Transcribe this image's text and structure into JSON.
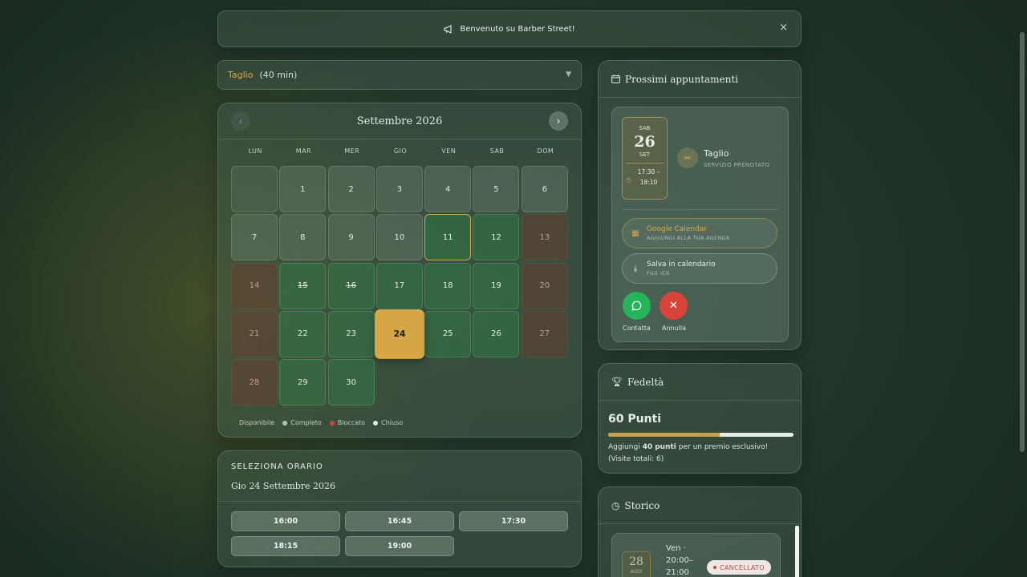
{
  "banner": {
    "icon": "megaphone-icon",
    "text": "Benvenuto su Barber Street!",
    "close": "×"
  },
  "service": {
    "name": "Taglio",
    "duration": "(40 min)",
    "arrow": "▼"
  },
  "calendar": {
    "month": "Settembre 2026",
    "prev": "‹",
    "next": "›",
    "weekdays": [
      "LUN",
      "MAR",
      "MER",
      "GIO",
      "VEN",
      "SAB",
      "DOM"
    ],
    "days": [
      {
        "d": "",
        "s": "empty"
      },
      {
        "d": "1",
        "s": "default"
      },
      {
        "d": "2",
        "s": "default"
      },
      {
        "d": "3",
        "s": "default"
      },
      {
        "d": "4",
        "s": "default"
      },
      {
        "d": "5",
        "s": "default"
      },
      {
        "d": "6",
        "s": "default"
      },
      {
        "d": "7",
        "s": "default"
      },
      {
        "d": "8",
        "s": "default"
      },
      {
        "d": "9",
        "s": "default"
      },
      {
        "d": "10",
        "s": "default"
      },
      {
        "d": "11",
        "s": "today"
      },
      {
        "d": "12",
        "s": "avail"
      },
      {
        "d": "13",
        "s": "closed"
      },
      {
        "d": "14",
        "s": "closed"
      },
      {
        "d": "15",
        "s": "full"
      },
      {
        "d": "16",
        "s": "full"
      },
      {
        "d": "17",
        "s": "avail"
      },
      {
        "d": "18",
        "s": "avail"
      },
      {
        "d": "19",
        "s": "avail"
      },
      {
        "d": "20",
        "s": "closed"
      },
      {
        "d": "21",
        "s": "closed"
      },
      {
        "d": "22",
        "s": "avail"
      },
      {
        "d": "23",
        "s": "avail"
      },
      {
        "d": "24",
        "s": "selected"
      },
      {
        "d": "25",
        "s": "avail"
      },
      {
        "d": "26",
        "s": "avail"
      },
      {
        "d": "27",
        "s": "closed"
      },
      {
        "d": "28",
        "s": "closed"
      },
      {
        "d": "29",
        "s": "avail"
      },
      {
        "d": "30",
        "s": "avail"
      }
    ],
    "legend": [
      {
        "label": "Disponibile",
        "color": "#2f5a3c"
      },
      {
        "label": "Completo",
        "color": "#b9c2bb"
      },
      {
        "label": "Bloccato",
        "color": "#c8453a"
      },
      {
        "label": "Chiuso",
        "color": "#e6e6e6"
      }
    ]
  },
  "slots": {
    "label": "SELEZIONA ORARIO",
    "date": "Gio 24 Settembre 2026",
    "times": [
      "16:00",
      "16:45",
      "17:30",
      "18:15",
      "19:00"
    ]
  },
  "appointments": {
    "title": "Prossimi appuntamenti",
    "dow": "SAB",
    "day": "26",
    "month": "SET",
    "time1": "17:30 –",
    "time2": "18:10",
    "service": "Taglio",
    "service_sub": "SERVIZIO PRENOTATO",
    "gcal_title": "Google Calendar",
    "gcal_sub": "AGGIUNGI ALLA TUA AGENDA",
    "ics_title": "Salva in calendario",
    "ics_sub": "FILE ICS",
    "contact": "Contatta",
    "cancel": "Annulla"
  },
  "loyalty": {
    "title": "Fedeltà",
    "points": "60 Punti",
    "progress": 0.6,
    "msg_pre": "Aggiungi ",
    "msg_bold": "40 punti",
    "msg_post": " per un premio esclusivo! (Visite totali: 6)"
  },
  "history": {
    "title": "Storico",
    "day": "28",
    "month": "AGO",
    "time1": "Ven ·",
    "time2": "20:00–",
    "time3": "21:00",
    "badge": "CANCELLATO"
  },
  "colors": {
    "accent": "#d6a645",
    "available": "#2f6e44",
    "closed": "#6e3c2d",
    "danger": "#d9443a",
    "success": "#27b35a"
  }
}
